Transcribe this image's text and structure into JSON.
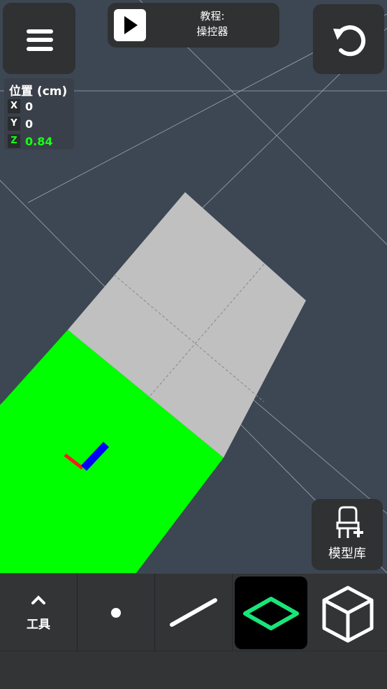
{
  "header": {
    "tutorial_label": "教程:",
    "tutorial_name": "操控器"
  },
  "position_panel": {
    "title": "位置 (cm)",
    "axes": [
      {
        "tag": "X",
        "value": "0"
      },
      {
        "tag": "Y",
        "value": "0"
      },
      {
        "tag": "Z",
        "value": "0.84"
      }
    ]
  },
  "model_library": {
    "label": "模型库"
  },
  "toolbar": {
    "tools_label": "工具",
    "items": [
      "tools",
      "point",
      "line",
      "face",
      "solid"
    ],
    "selected": "face"
  },
  "colors": {
    "scene_bg": "#3d4753",
    "selected_face": "#00ff00",
    "face": "#c0c0c0",
    "accent_green": "#19ff19",
    "panel": "#2f3132"
  },
  "icons": [
    "menu-icon",
    "play-icon",
    "undo-icon",
    "chair-add-icon",
    "chevron-up-icon",
    "point-icon",
    "line-icon",
    "diamond-face-icon",
    "cube-icon"
  ]
}
